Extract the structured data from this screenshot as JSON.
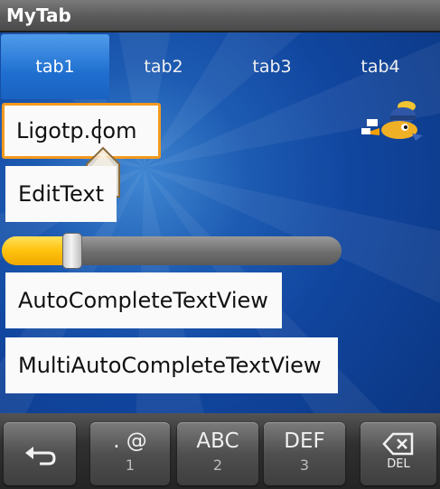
{
  "app": {
    "title": "MyTab"
  },
  "tabs": [
    {
      "label": "tab1",
      "selected": true
    },
    {
      "label": "tab2",
      "selected": false
    },
    {
      "label": "tab3",
      "selected": false
    },
    {
      "label": "tab4",
      "selected": false
    }
  ],
  "form": {
    "url_field": {
      "value": "Ligotp.com",
      "focused": true
    },
    "edit_text": {
      "value": "EditText"
    },
    "seekbar": {
      "progress": 0.19
    },
    "autocomplete": {
      "value": "AutoCompleteTextView"
    },
    "multi_autocomplete": {
      "value": "MultiAutoCompleteTextView"
    }
  },
  "keyboard": {
    "back_icon": "return-arrow-icon",
    "keys": [
      {
        "main": ". @",
        "sub": "1"
      },
      {
        "main": "ABC",
        "sub": "2"
      },
      {
        "main": "DEF",
        "sub": "3"
      }
    ],
    "delete": {
      "label": "DEL",
      "icon": "backspace-icon"
    }
  },
  "colors": {
    "accent_focus": "#f39a1f",
    "seek_fill": "#ffc20e",
    "background": "#1d5bb2"
  }
}
